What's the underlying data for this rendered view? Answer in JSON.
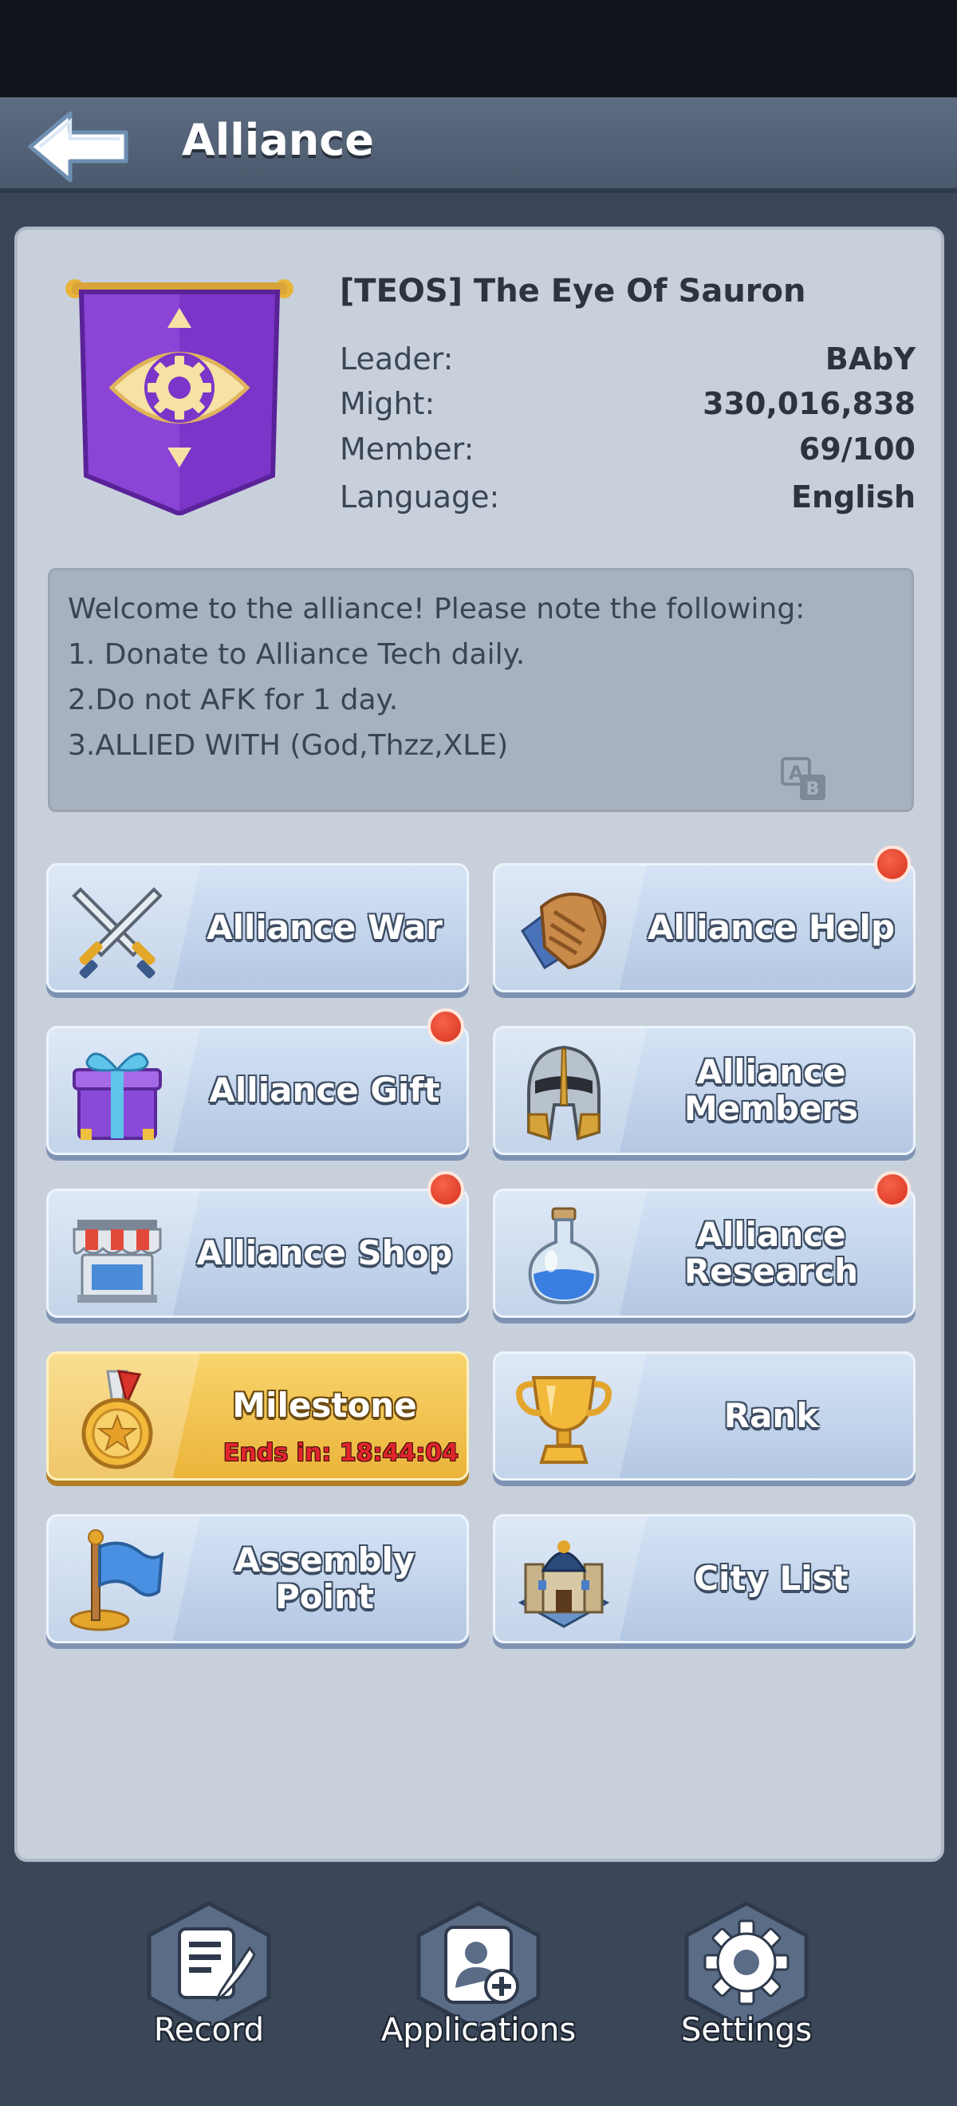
{
  "header": {
    "title": "Alliance",
    "back_icon": "back-arrow-icon"
  },
  "alliance": {
    "name": "[TEOS] The Eye Of Sauron",
    "banner_icon": "eye-gear-banner-icon",
    "info": [
      {
        "label": "Leader:",
        "value": "BAbY"
      },
      {
        "label": "Might:",
        "value": "330,016,838"
      },
      {
        "label": "Member:",
        "value": "69/100"
      },
      {
        "label": "Language:",
        "value": "English"
      }
    ],
    "notice_lines": [
      "Welcome to the alliance! Please note the following:",
      "1. Donate to Alliance Tech daily.",
      "2.Do not AFK for 1 day.",
      "3.ALLIED WITH (God,Thzz,XLE)"
    ]
  },
  "tiles": [
    {
      "label": "Alliance War",
      "icon": "crossed-swords-icon",
      "notification": false
    },
    {
      "label": "Alliance Help",
      "icon": "handshake-icon",
      "notification": true
    },
    {
      "label": "Alliance Gift",
      "icon": "gift-box-icon",
      "notification": true
    },
    {
      "label": "Alliance Members",
      "icon": "helmet-icon",
      "notification": false
    },
    {
      "label": "Alliance Shop",
      "icon": "shop-stall-icon",
      "notification": true
    },
    {
      "label": "Alliance Research",
      "icon": "potion-flask-icon",
      "notification": true
    },
    {
      "label": "Milestone",
      "icon": "star-medal-icon",
      "notification": false,
      "timer": "Ends in: 18:44:04"
    },
    {
      "label": "Rank",
      "icon": "trophy-icon",
      "notification": false
    },
    {
      "label": "Assembly Point",
      "icon": "flag-icon",
      "notification": false
    },
    {
      "label": "City List",
      "icon": "castle-icon",
      "notification": false
    }
  ],
  "bottom_nav": [
    {
      "label": "Record",
      "icon": "record-quill-icon"
    },
    {
      "label": "Applications",
      "icon": "add-user-icon"
    },
    {
      "label": "Settings",
      "icon": "gear-icon"
    }
  ],
  "colors": {
    "accent_gold": "#ebb43a",
    "notification_red": "#d8321f",
    "timer_red": "#e0252c"
  }
}
